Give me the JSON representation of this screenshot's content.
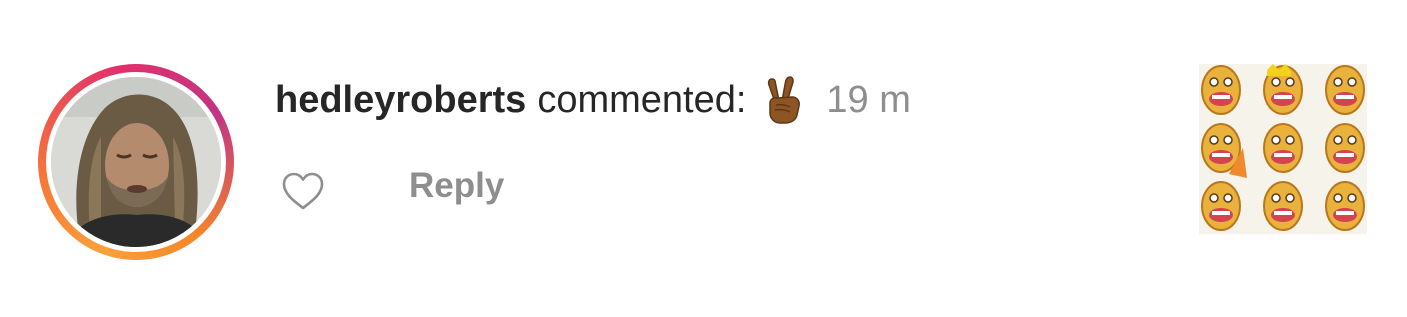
{
  "notification": {
    "username": "hedleyroberts",
    "action": "commented:",
    "comment_emoji": "✌🏾",
    "timestamp": "19 m",
    "reply_label": "Reply",
    "like_icon": "heart-outline-icon",
    "avatar_story_ring": true
  },
  "colors": {
    "text_primary": "#262626",
    "text_secondary": "#8e8e8e",
    "story_ring_start": "#f9a13a",
    "story_ring_end": "#c13584"
  }
}
